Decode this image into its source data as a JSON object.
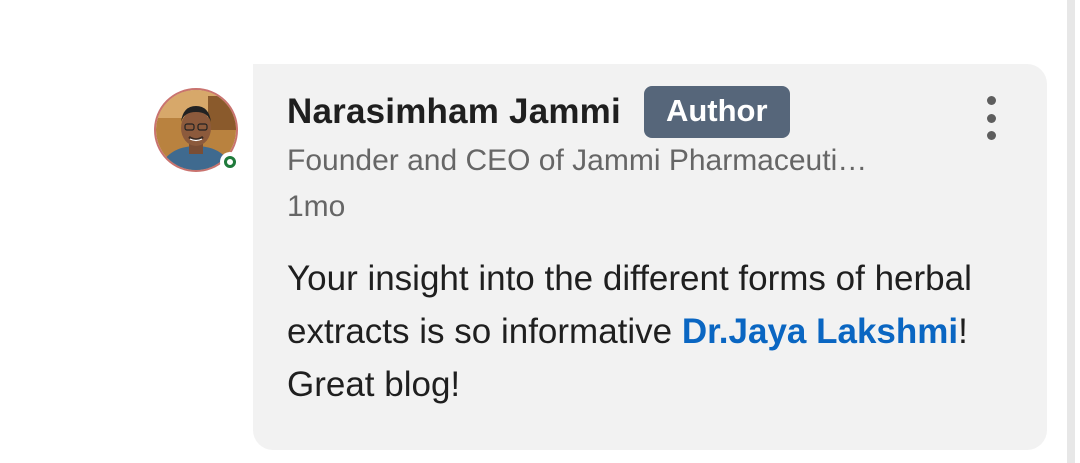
{
  "comment": {
    "author_name": "Narasimham Jammi",
    "badge": "Author",
    "headline": "Founder and CEO of Jammi Pharmaceuti…",
    "timestamp": "1mo",
    "text_before": "Your insight into the different forms of herbal extracts is so informative ",
    "mention": "Dr.Jaya Lakshmi",
    "text_after": "! Great blog!"
  },
  "icons": {
    "avatar": "profile-photo",
    "presence": "online-status-icon",
    "more": "more-options-icon"
  },
  "colors": {
    "bubble_bg": "#f2f2f2",
    "badge_bg": "#56667a",
    "mention": "#0a66c2",
    "presence": "#1f7a3b"
  }
}
